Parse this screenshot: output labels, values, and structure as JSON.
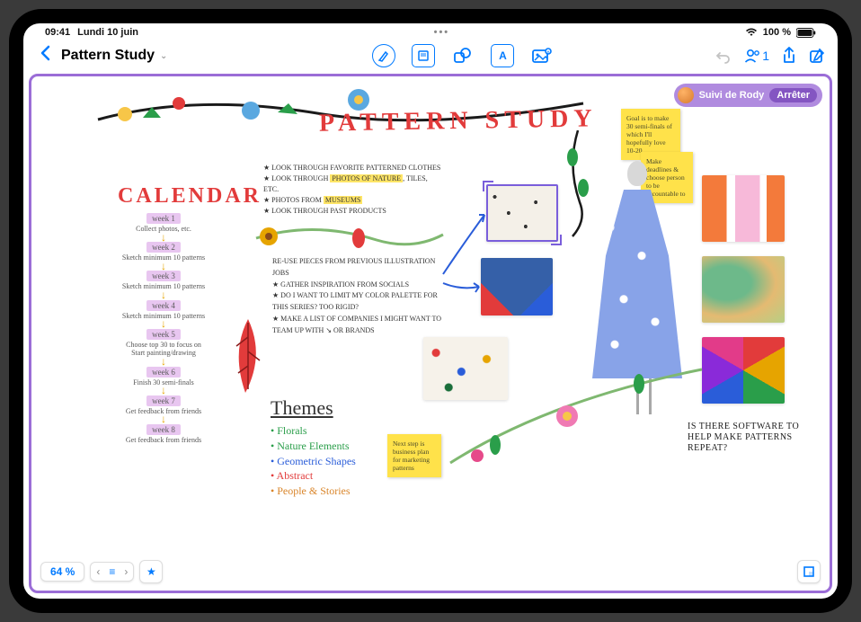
{
  "status": {
    "time": "09:41",
    "date": "Lundi 10 juin",
    "battery": "100 %"
  },
  "toolbar": {
    "board_title": "Pattern Study",
    "collab_count": "1"
  },
  "following": {
    "label": "Suivi de Rody",
    "stop": "Arrêter"
  },
  "canvas": {
    "big_title": "PATTERN STUDY",
    "calendar_heading": "CALENDAR",
    "weeks": [
      {
        "label": "week 1",
        "desc": "Collect photos, etc."
      },
      {
        "label": "week 2",
        "desc": "Sketch minimum 10 patterns"
      },
      {
        "label": "week 3",
        "desc": "Sketch minimum 10 patterns"
      },
      {
        "label": "week 4",
        "desc": "Sketch minimum 10 patterns"
      },
      {
        "label": "week 5",
        "desc": "Choose top 30 to focus on\nStart painting/drawing"
      },
      {
        "label": "week 6",
        "desc": "Finish 30 semi-finals"
      },
      {
        "label": "week 7",
        "desc": "Get feedback from friends"
      },
      {
        "label": "week 8",
        "desc": "Get feedback from friends"
      }
    ],
    "notes_top": [
      "★ LOOK THROUGH FAVORITE PATTERNED CLOTHES",
      "★ LOOK THROUGH PHOTOS OF NATURE, TILES, ETC.",
      "★ PHOTOS FROM MUSEUMS",
      "★ LOOK THROUGH PAST PRODUCTS"
    ],
    "notes_mid": [
      "RE-USE PIECES FROM PREVIOUS ILLUSTRATION JOBS",
      "★ GATHER INSPIRATION FROM SOCIALS",
      "★ DO I WANT TO LIMIT MY COLOR PALETTE FOR THIS SERIES? TOO RIGID?",
      "★ MAKE A LIST OF COMPANIES I MIGHT WANT TO TEAM UP WITH  ↘ OR BRANDS"
    ],
    "themes_heading": "Themes",
    "themes": [
      "• Florals",
      "• Nature Elements",
      "• Geometric Shapes",
      "• Abstract",
      "• People & Stories"
    ],
    "stickies": {
      "goal": "Goal is to make 30 semi-finals of which I'll hopefully love 10-20",
      "deadlines": "Make deadlines & choose person to be accountable to",
      "nextstep": "Next step is business plan for marketing patterns"
    },
    "hand_note": "IS THERE SOFTWARE TO HELP MAKE PATTERNS REPEAT?"
  },
  "bottom": {
    "zoom": "64 %"
  }
}
